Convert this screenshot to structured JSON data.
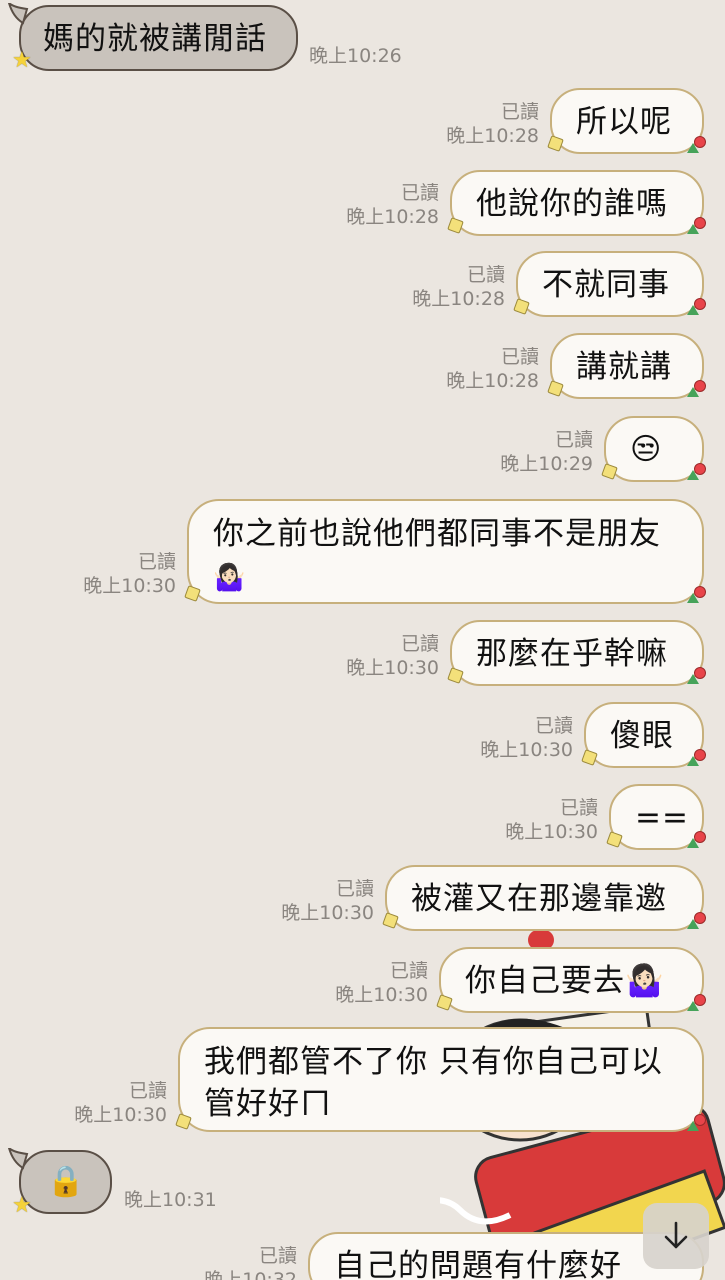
{
  "messages": [
    {
      "dir": "in",
      "text": "媽的就被講閒話",
      "time": "晚上10:26"
    },
    {
      "dir": "out",
      "text": "所以呢",
      "read": "已讀",
      "time": "晚上10:28"
    },
    {
      "dir": "out",
      "text": "他說你的誰嗎",
      "read": "已讀",
      "time": "晚上10:28"
    },
    {
      "dir": "out",
      "text": "不就同事",
      "read": "已讀",
      "time": "晚上10:28"
    },
    {
      "dir": "out",
      "text": "講就講",
      "read": "已讀",
      "time": "晚上10:28"
    },
    {
      "dir": "out",
      "text": "😒",
      "read": "已讀",
      "time": "晚上10:29"
    },
    {
      "dir": "out",
      "line1": "你之前也說他們都同事不是朋友",
      "line2": "🤷🏻‍♀️",
      "read": "已讀",
      "time": "晚上10:30"
    },
    {
      "dir": "out",
      "text": "那麼在乎幹嘛",
      "read": "已讀",
      "time": "晚上10:30"
    },
    {
      "dir": "out",
      "text": "傻眼",
      "read": "已讀",
      "time": "晚上10:30"
    },
    {
      "dir": "out",
      "text": "==",
      "read": "已讀",
      "time": "晚上10:30"
    },
    {
      "dir": "out",
      "text": "被灌又在那邊靠邀",
      "read": "已讀",
      "time": "晚上10:30"
    },
    {
      "dir": "out",
      "text": "你自己要去🤷🏻‍♀️",
      "read": "已讀",
      "time": "晚上10:30"
    },
    {
      "dir": "out",
      "line1": "我們都管不了你 只有你自己可以",
      "line2": "管好好ㄇ",
      "read": "已讀",
      "time": "晚上10:30"
    },
    {
      "dir": "in",
      "text": "🔒",
      "time": "晚上10:31"
    },
    {
      "dir": "out",
      "text": "自己的問題有什麼好",
      "read": "已讀",
      "time": "晚上10:32"
    }
  ],
  "scroll_button": {
    "icon": "arrow-down-icon"
  }
}
